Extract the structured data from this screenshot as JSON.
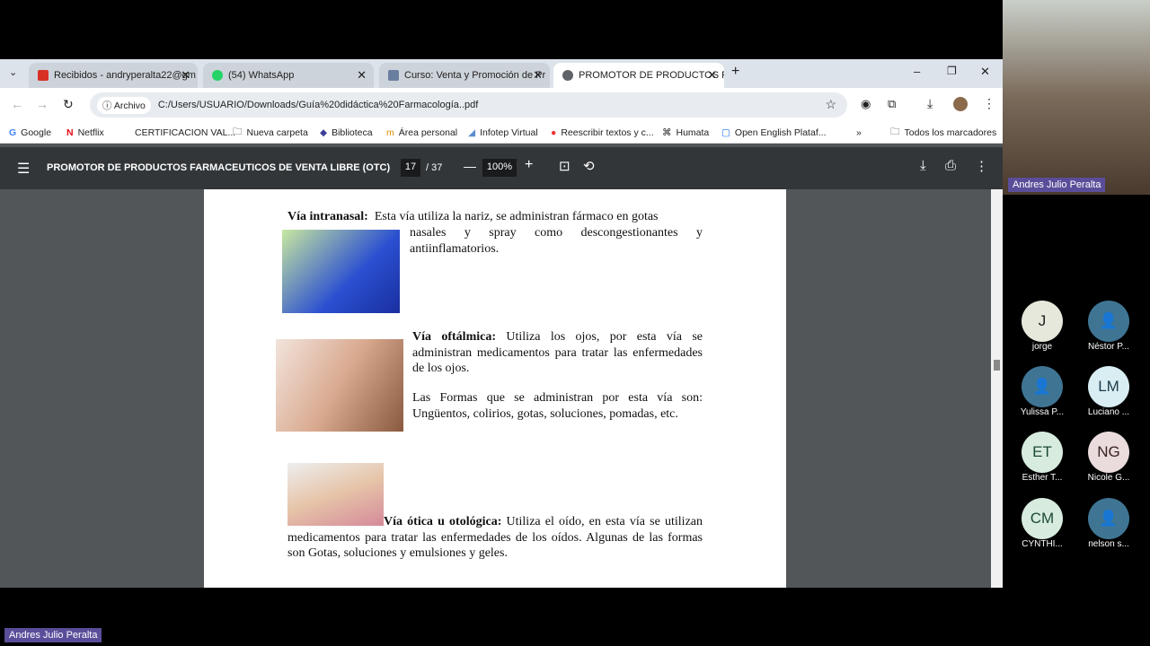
{
  "tabs": [
    {
      "label": "Recibidos - andryperalta22@gm",
      "icon": "gmail-icon",
      "color": "#d93025"
    },
    {
      "label": "(54) WhatsApp",
      "icon": "whatsapp-icon",
      "color": "#25d366"
    },
    {
      "label": "Curso: Venta y Promoción de Pr",
      "icon": "course-icon",
      "color": "#6a7fa0"
    },
    {
      "label": "PROMOTOR DE PRODUCTOS FA",
      "icon": "globe-icon",
      "color": "#5f6368"
    }
  ],
  "toolbar": {
    "archivo": "Archivo",
    "url": "C:/Users/USUARIO/Downloads/Guía%20didáctica%20Farmacología..pdf"
  },
  "bookmarks": [
    "Google",
    "Netflix",
    "CERTIFICACION VAL...",
    "Nueva carpeta",
    "Biblioteca",
    "Área personal",
    "Infotep Virtual",
    "Reescribir textos y c...",
    "Humata",
    "Open English Plataf..."
  ],
  "all_bookmarks": "Todos los marcadores",
  "pdf": {
    "title": "PROMOTOR DE PRODUCTOS FARMACEUTICOS DE VENTA LIBRE (OTC)",
    "page": "17",
    "total": "/ 37",
    "zoom": "100%"
  },
  "doc": {
    "intranasal_title": "Vía intranasal:",
    "intranasal_text": "Esta vía utiliza la nariz, se administran fármaco en gotas",
    "intranasal_text2": "nasales y spray como descongestionantes y antiinflamatorios.",
    "oftalmica_title": "Vía oftálmica:",
    "oftalmica_text": "Utiliza los ojos, por esta vía se administran medicamentos para tratar las enfermedades de los ojos.",
    "oftalmica_formas": "Las Formas que se administran por esta vía son: Ungüentos, colirios, gotas, soluciones, pomadas, etc.",
    "otica_title": "Vía ótica u otológica:",
    "otica_text": "Utiliza el oído, en esta vía se utilizan medicamentos para tratar las enfermedades de los oídos. Algunas de las formas son Gotas, soluciones y emulsiones y geles."
  },
  "presenter": "Andres Julio Peralta",
  "participants": [
    {
      "initials": "J",
      "name": "jorge",
      "bg": "#e6e8dc"
    },
    {
      "initials": "",
      "name": "Néstor P...",
      "bg": "#3f7593"
    },
    {
      "initials": "",
      "name": "Yulissa P...",
      "bg": "#3f7593"
    },
    {
      "initials": "LM",
      "name": "Luciano ...",
      "bg": "#d9eef3"
    },
    {
      "initials": "ET",
      "name": "Esther T...",
      "bg": "#d7ecdf"
    },
    {
      "initials": "NG",
      "name": "Nicole G...",
      "bg": "#eadcdc"
    },
    {
      "initials": "CM",
      "name": "CYNTHI...",
      "bg": "#d7ecdf"
    },
    {
      "initials": "",
      "name": "nelson s...",
      "bg": "#3f7593"
    }
  ]
}
